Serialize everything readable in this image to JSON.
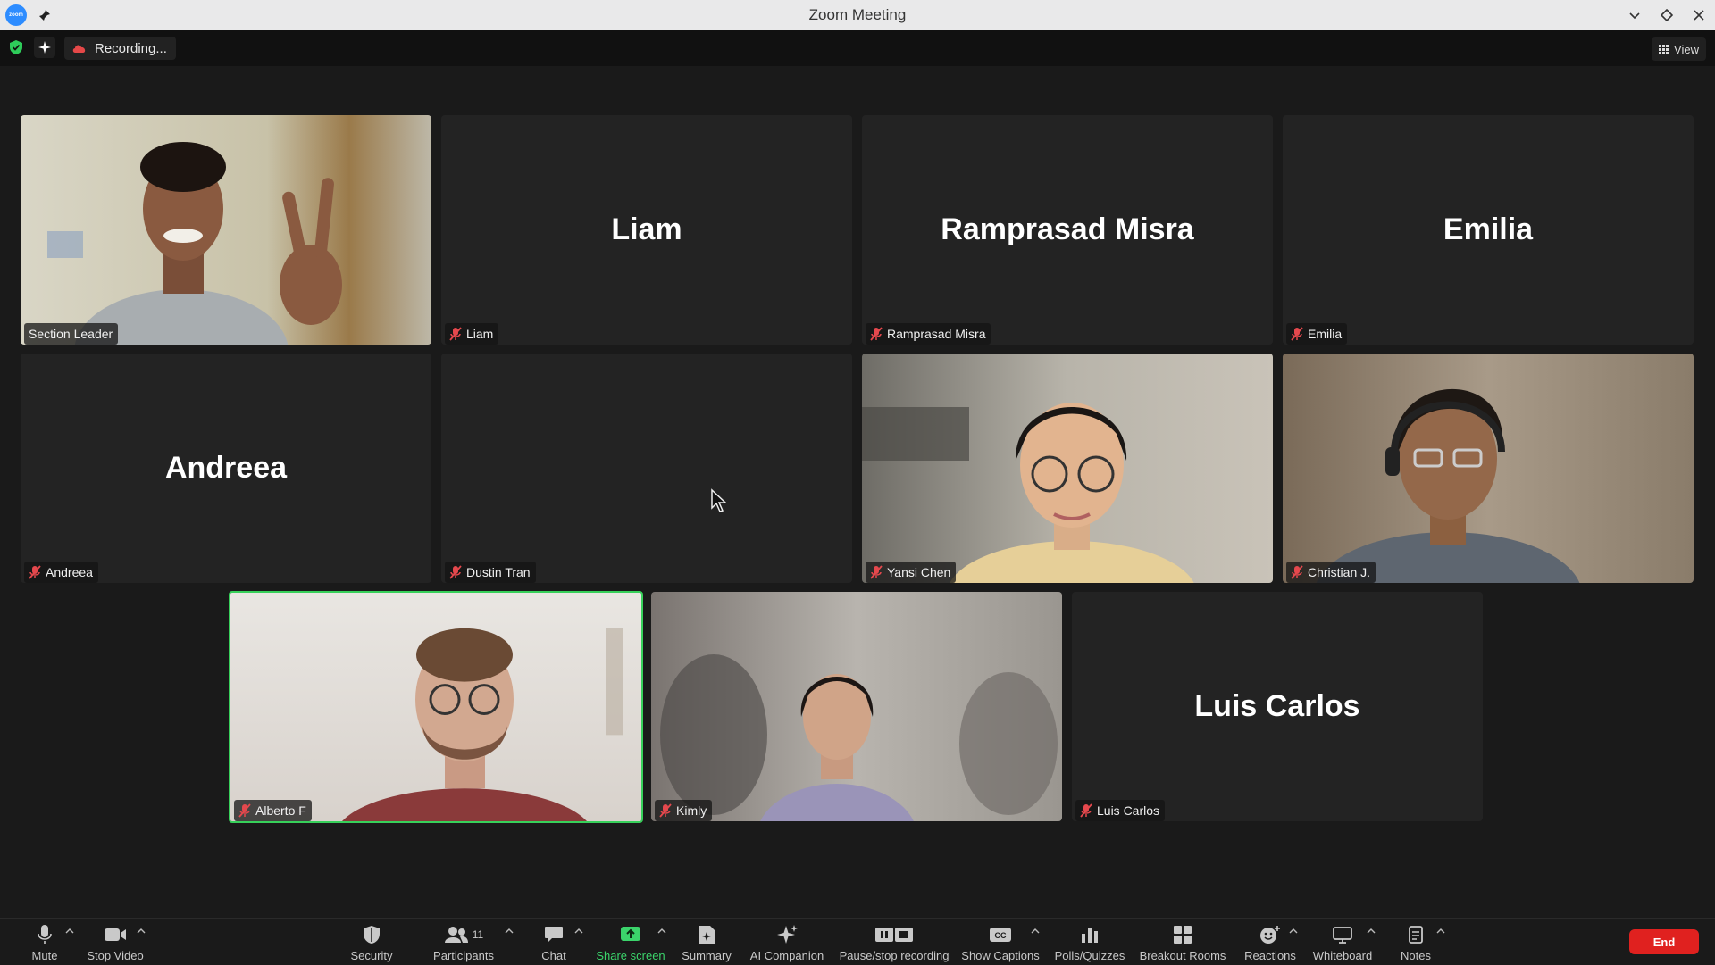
{
  "window": {
    "title": "Zoom Meeting",
    "logo_text": "zoom"
  },
  "header": {
    "recording_label": "Recording...",
    "view_label": "View"
  },
  "tiles": [
    {
      "name": "Section Leader",
      "big_name": "",
      "muted": false,
      "video": true
    },
    {
      "name": "Liam",
      "big_name": "Liam",
      "muted": true,
      "video": false
    },
    {
      "name": "Ramprasad Misra",
      "big_name": "Ramprasad Misra",
      "muted": true,
      "video": false
    },
    {
      "name": "Emilia",
      "big_name": "Emilia",
      "muted": true,
      "video": false
    },
    {
      "name": "Andreea",
      "big_name": "Andreea",
      "muted": true,
      "video": false
    },
    {
      "name": "Dustin Tran",
      "big_name": "",
      "muted": true,
      "video": false
    },
    {
      "name": "Yansi Chen",
      "big_name": "",
      "muted": true,
      "video": true
    },
    {
      "name": "Christian J.",
      "big_name": "",
      "muted": true,
      "video": true
    },
    {
      "name": "Alberto F",
      "big_name": "",
      "muted": true,
      "video": true,
      "active_speaker": true
    },
    {
      "name": "Kimly",
      "big_name": "",
      "muted": true,
      "video": true
    },
    {
      "name": "Luis Carlos",
      "big_name": "Luis Carlos",
      "muted": true,
      "video": false
    }
  ],
  "toolbar": {
    "mute": "Mute",
    "stop_video": "Stop Video",
    "security": "Security",
    "participants": "Participants",
    "participants_count": "11",
    "chat": "Chat",
    "share_screen": "Share screen",
    "summary": "Summary",
    "ai_companion": "AI Companion",
    "pause_recording": "Pause/stop recording",
    "show_captions": "Show Captions",
    "polls": "Polls/Quizzes",
    "breakout": "Breakout Rooms",
    "reactions": "Reactions",
    "whiteboard": "Whiteboard",
    "notes": "Notes",
    "end": "End"
  },
  "colors": {
    "accent_green": "#37d05a",
    "end_red": "#e0211f",
    "zoom_blue": "#2d8cff"
  }
}
